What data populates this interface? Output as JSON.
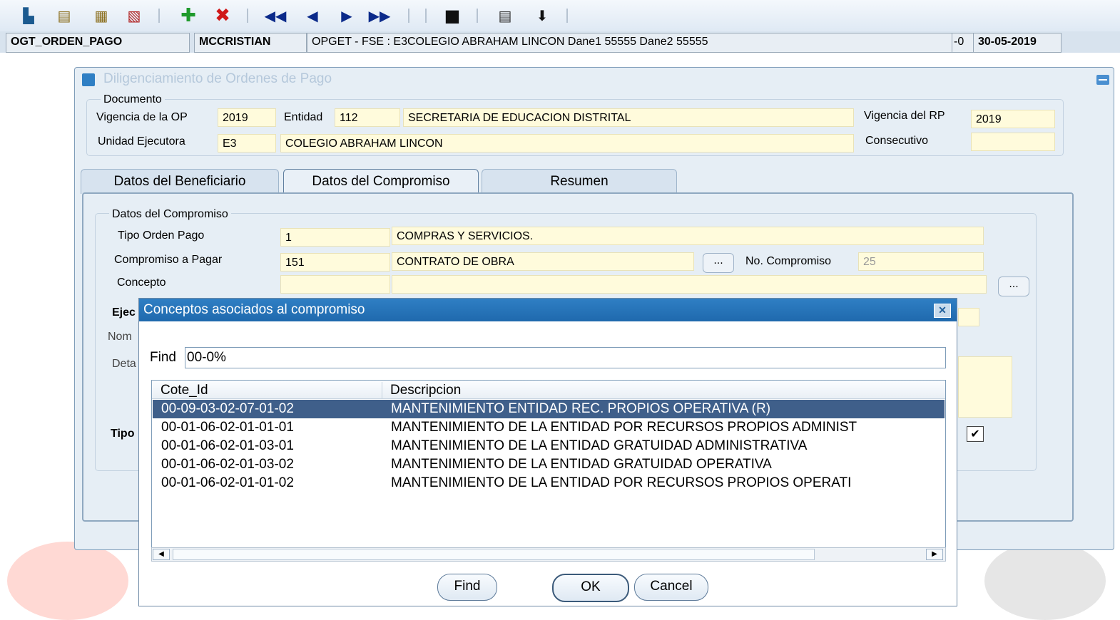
{
  "toolbar": {
    "buttons": [
      {
        "name": "exit-icon"
      },
      {
        "name": "query-icon"
      },
      {
        "name": "execute-query-icon"
      },
      {
        "name": "cancel-query-icon"
      },
      {
        "name": "insert-record-icon"
      },
      {
        "name": "delete-record-icon"
      },
      {
        "name": "first-record-icon"
      },
      {
        "name": "previous-record-icon"
      },
      {
        "name": "next-record-icon"
      },
      {
        "name": "last-record-icon"
      },
      {
        "name": "save-icon"
      },
      {
        "name": "print-icon"
      },
      {
        "name": "download-icon"
      }
    ]
  },
  "status": {
    "form": "OGT_ORDEN_PAGO",
    "user": "MCCRISTIAN",
    "context": "OPGET - FSE : E3COLEGIO ABRAHAM LINCON Dane1 55555 Dane2 55555",
    "extra": "-0",
    "date": "30-05-2019"
  },
  "window": {
    "title": "Diligenciamiento de Ordenes de Pago",
    "documento": {
      "group_label": "Documento",
      "vigencia_op_label": "Vigencia de la OP",
      "vigencia_op": "2019",
      "entidad_label": "Entidad",
      "entidad_code": "112",
      "entidad_name": "SECRETARIA DE EDUCACION DISTRITAL",
      "vigencia_rp_label": "Vigencia del RP",
      "vigencia_rp": "2019",
      "unidad_label": "Unidad Ejecutora",
      "unidad_code": "E3",
      "unidad_name": "COLEGIO ABRAHAM LINCON",
      "consecutivo_label": "Consecutivo",
      "consecutivo": ""
    },
    "tabs": [
      {
        "label": "Datos del Beneficiario"
      },
      {
        "label": "Datos del Compromiso"
      },
      {
        "label": "Resumen"
      }
    ],
    "compromiso": {
      "group_label": "Datos del Compromiso",
      "tipo_label": "Tipo Orden Pago",
      "tipo_code": "1",
      "tipo_name": "COMPRAS Y SERVICIOS.",
      "comp_label": "Compromiso a Pagar",
      "comp_code": "151",
      "comp_name": "CONTRATO DE OBRA",
      "lov_label": "...",
      "no_comp_label": "No. Compromiso",
      "no_comp": "25",
      "concepto_label": "Concepto",
      "concepto_code": "",
      "concepto_name": "",
      "ejec_label": "Ejec",
      "nom_label": "Nom",
      "deta_label": "Deta",
      "tipo2_label": "Tipo"
    }
  },
  "dialog": {
    "title": "Conceptos asociados al compromiso",
    "find_label": "Find",
    "find_value": "00-0%",
    "columns": [
      "Cote_Id",
      "Descripcion"
    ],
    "rows": [
      {
        "id": "00-09-03-02-07-01-02",
        "desc": "MANTENIMIENTO ENTIDAD REC. PROPIOS OPERATIVA (R)"
      },
      {
        "id": "00-01-06-02-01-01-01",
        "desc": "MANTENIMIENTO DE LA ENTIDAD POR RECURSOS PROPIOS ADMINIST"
      },
      {
        "id": "00-01-06-02-01-03-01",
        "desc": "MANTENIMIENTO DE LA ENTIDAD GRATUIDAD ADMINISTRATIVA"
      },
      {
        "id": "00-01-06-02-01-03-02",
        "desc": "MANTENIMIENTO DE LA ENTIDAD GRATUIDAD OPERATIVA"
      },
      {
        "id": "00-01-06-02-01-01-02",
        "desc": "MANTENIMIENTO DE LA ENTIDAD POR RECURSOS PROPIOS OPERATI"
      }
    ],
    "buttons": {
      "find": "Find",
      "ok": "OK",
      "cancel": "Cancel"
    }
  },
  "colors": {
    "accent": "#1f69ad",
    "field": "#fffbdc",
    "selection": "#3f5f8a",
    "watermark": "#e8242b"
  }
}
